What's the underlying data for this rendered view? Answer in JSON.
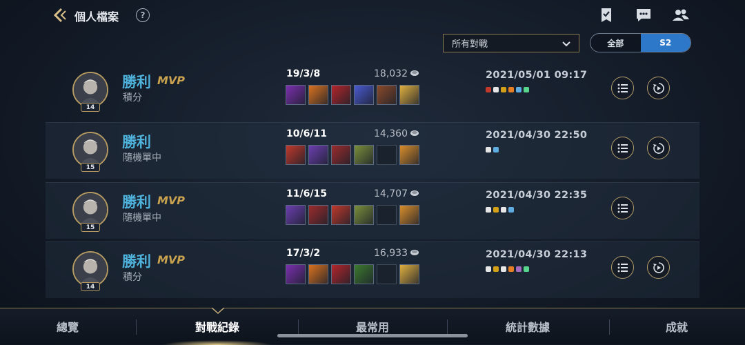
{
  "header": {
    "title": "個人檔案",
    "help_label": "?"
  },
  "filters": {
    "match_filter": "所有對戰",
    "season_options": [
      "全部",
      "S2"
    ],
    "season_selected": "S2"
  },
  "matches": [
    {
      "result": "勝利",
      "mvp": "MVP",
      "mode": "積分",
      "level": "14",
      "kda": "19/3/8",
      "gold": "18,032",
      "date": "2021/05/01 09:17",
      "items": [
        "#7b2fae",
        "#d9721f",
        "#b3262a",
        "#4a5ad0",
        "#8a4a2a",
        "#e0b040"
      ],
      "badges": [
        "#c0392b",
        "#e6e6e6",
        "#d4a017",
        "#e67e22",
        "#5dade2",
        "#58d68d"
      ],
      "has_replay": true
    },
    {
      "result": "勝利",
      "mvp": "",
      "mode": "隨機單中",
      "level": "15",
      "kda": "10/6/11",
      "gold": "14,360",
      "date": "2021/04/30 22:50",
      "items": [
        "#c0392b",
        "#6c3fb0",
        "#9b2c2c",
        "#7a8f3a",
        "",
        "#d98e2b"
      ],
      "badges": [
        "#e6e6e6",
        "#5dade2"
      ],
      "has_replay": true
    },
    {
      "result": "勝利",
      "mvp": "MVP",
      "mode": "隨機單中",
      "level": "15",
      "kda": "11/6/15",
      "gold": "14,707",
      "date": "2021/04/30 22:35",
      "items": [
        "#6c3fb0",
        "#9b2c2c",
        "#c0392b",
        "#7a8f3a",
        "",
        "#d98e2b"
      ],
      "badges": [
        "#e6e6e6",
        "#d4a017",
        "#e6e6e6",
        "#5dade2"
      ],
      "has_replay": false
    },
    {
      "result": "勝利",
      "mvp": "MVP",
      "mode": "積分",
      "level": "14",
      "kda": "17/3/2",
      "gold": "16,933",
      "date": "2021/04/30 22:13",
      "items": [
        "#7b2fae",
        "#d9721f",
        "#b3262a",
        "#3d7a2e",
        "",
        "#e0b040"
      ],
      "badges": [
        "#e6e6e6",
        "#d4a017",
        "#e6e6e6",
        "#e67e22",
        "#a569bd",
        "#58d68d"
      ],
      "has_replay": true
    }
  ],
  "nav": {
    "items": [
      "總覽",
      "對戰紀錄",
      "最常用",
      "統計數據",
      "成就"
    ],
    "active": "對戰紀錄"
  },
  "colors": {
    "win": "#4fb3dc",
    "mvp": "#c9a24f",
    "accent_gold": "#b39e6c",
    "toggle_active": "#2e78c9"
  }
}
